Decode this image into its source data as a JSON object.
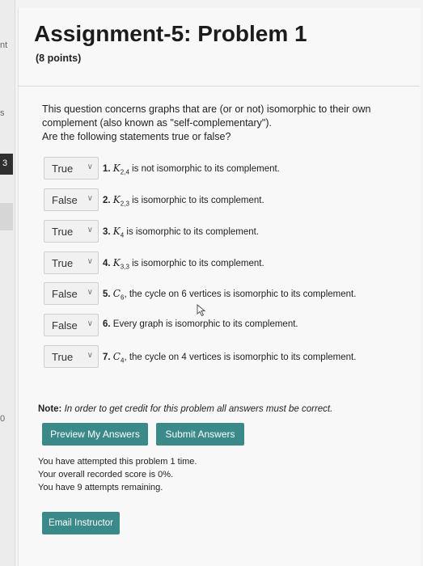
{
  "rail": {
    "frag1": "nt",
    "frag2": "s",
    "frag3": "3",
    "frag4": "0"
  },
  "header": {
    "title": "Assignment-5: Problem 1",
    "points": "(8 points)"
  },
  "intro": {
    "line1": "This question concerns graphs that are (or or not) isomorphic to their own",
    "line2": "complement (also known as \"self-complementary\").",
    "line3": "Are the following statements true or false?"
  },
  "questions": [
    {
      "answer": "True",
      "num": "1.",
      "sym": "K",
      "sub": "2,4",
      "rest": " is not isomorphic to its complement."
    },
    {
      "answer": "False",
      "num": "2.",
      "sym": "K",
      "sub": "2,3",
      "rest": " is isomorphic to its complement."
    },
    {
      "answer": "True",
      "num": "3.",
      "sym": "K",
      "sub": "4",
      "rest": " is isomorphic to its complement."
    },
    {
      "answer": "True",
      "num": "4.",
      "sym": "K",
      "sub": "3,3",
      "rest": " is isomorphic to its complement."
    },
    {
      "answer": "False",
      "num": "5.",
      "sym": "C",
      "sub": "6",
      "rest": ", the cycle on 6 vertices is isomorphic to its complement."
    },
    {
      "answer": "False",
      "num": "6.",
      "sym": "",
      "sub": "",
      "rest": "Every graph is isomorphic to its complement."
    },
    {
      "answer": "True",
      "num": "7.",
      "sym": "C",
      "sub": "4",
      "rest": ", the cycle on 4 vertices is isomorphic to its complement."
    }
  ],
  "note": {
    "label": "Note:",
    "text": "In order to get credit for this problem all answers must be correct."
  },
  "buttons": {
    "preview": "Preview My Answers",
    "submit": "Submit Answers",
    "email": "Email Instructor"
  },
  "status": {
    "line1": "You have attempted this problem 1 time.",
    "line2": "Your overall recorded score is 0%.",
    "line3": "You have 9 attempts remaining."
  },
  "colors": {
    "button": "#3b8a8a",
    "background": "#f3f3f3"
  }
}
